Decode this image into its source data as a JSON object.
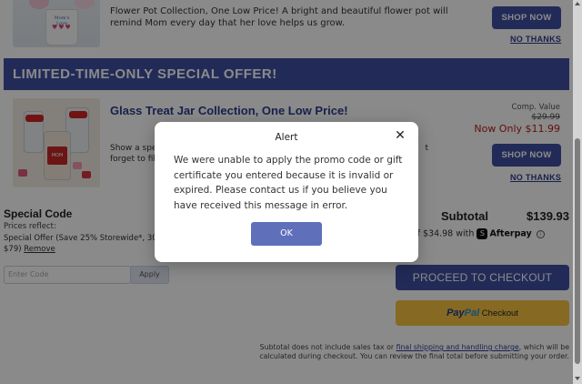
{
  "product_top": {
    "image_alt_text": "Mom's Love",
    "description": "Flower Pot Collection, One Low Price! A bright and beautiful flower pot will remind Mom every day that her love helps us grow.",
    "shop_label": "SHOP NOW",
    "no_thanks_label": "NO THANKS"
  },
  "banner": {
    "title": "LIMITED-TIME-ONLY SPECIAL OFFER!"
  },
  "product_offer": {
    "title": "Glass Treat Jar Collection, One Low Price!",
    "description_line1": "Show a spe",
    "description_line1_end": "t",
    "description_line2": "forget to fil",
    "comp_label": "Comp. Value",
    "comp_price": "$29.99",
    "now_label": "Now Only $11.99",
    "jar_label_text": "MOM",
    "shop_label": "SHOP NOW",
    "no_thanks_label": "NO THANKS"
  },
  "special_code": {
    "title": "Special Code",
    "prices_reflect": "Prices reflect:",
    "offer_line1": "Special Offer (Save 25% Storewide*, 30%",
    "offer_line2_prefix": "$79)",
    "remove_label": "Remove",
    "input_placeholder": "Enter Code",
    "apply_label": "Apply"
  },
  "summary": {
    "subtotal_label": "Subtotal",
    "subtotal_value": "$139.93",
    "installments_text": "ments of $34.98 with",
    "afterpay_badge": "S",
    "afterpay_label": "Afterpay",
    "afterpay_info": "i",
    "checkout_label": "PROCEED TO CHECKOUT",
    "paypal_pay": "Pay",
    "paypal_pal": "Pal",
    "paypal_checkout": "Checkout"
  },
  "footnote": {
    "prefix": "Subtotal does not include sales tax or ",
    "link": "final shipping and handling charge",
    "suffix": ", which will be calculated during checkout. You can review the final total before submitting your order."
  },
  "modal": {
    "title": "Alert",
    "close_glyph": "✕",
    "message": "We were unable to apply the promo code or gift certificate you entered because it is invalid or expired. Please contact us if you believe you have received this message in error.",
    "ok_label": "OK"
  },
  "colors": {
    "brand_blue": "#3f51a3",
    "price_red": "#b71c1c",
    "paypal_yellow": "#f7c341",
    "ok_button": "#5f6fba"
  }
}
